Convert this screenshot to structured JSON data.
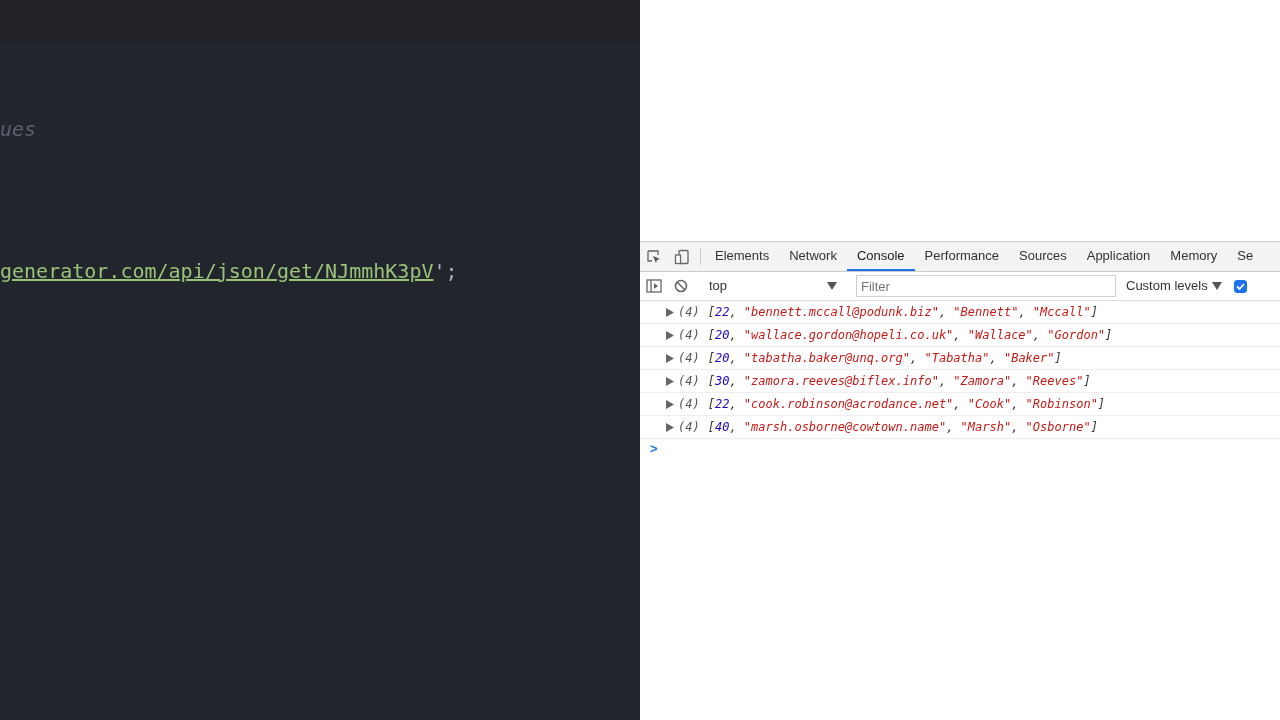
{
  "editor": {
    "comment": "ues",
    "code_line": {
      "url": "generator.com/api/json/get/NJmmhK3pV",
      "rest": "';"
    }
  },
  "devtools": {
    "tabs": [
      {
        "label": "Elements",
        "selected": false
      },
      {
        "label": "Network",
        "selected": false
      },
      {
        "label": "Console",
        "selected": true
      },
      {
        "label": "Performance",
        "selected": false
      },
      {
        "label": "Sources",
        "selected": false
      },
      {
        "label": "Application",
        "selected": false
      },
      {
        "label": "Memory",
        "selected": false
      },
      {
        "label": "Se",
        "selected": false
      }
    ],
    "toolbar": {
      "context": "top",
      "filter": {
        "placeholder": "Filter"
      },
      "levels": "Custom levels",
      "group_checkbox": {
        "checked": true
      }
    },
    "console_rows": [
      {
        "expanded": false,
        "count": "(4)",
        "open": "[",
        "close": "]",
        "items": [
          {
            "kind": "number",
            "text": "22"
          },
          {
            "kind": "string",
            "text": "\"bennett.mccall@podunk.biz\""
          },
          {
            "kind": "string",
            "text": "\"Bennett\""
          },
          {
            "kind": "string",
            "text": "\"Mccall\""
          }
        ]
      },
      {
        "expanded": false,
        "count": "(4)",
        "open": "[",
        "close": "]",
        "items": [
          {
            "kind": "number",
            "text": "20"
          },
          {
            "kind": "string",
            "text": "\"wallace.gordon@hopeli.co.uk\""
          },
          {
            "kind": "string",
            "text": "\"Wallace\""
          },
          {
            "kind": "string",
            "text": "\"Gordon\""
          }
        ]
      },
      {
        "expanded": false,
        "count": "(4)",
        "open": "[",
        "close": "]",
        "items": [
          {
            "kind": "number",
            "text": "20"
          },
          {
            "kind": "string",
            "text": "\"tabatha.baker@unq.org\""
          },
          {
            "kind": "string",
            "text": "\"Tabatha\""
          },
          {
            "kind": "string",
            "text": "\"Baker\""
          }
        ]
      },
      {
        "expanded": false,
        "count": "(4)",
        "open": "[",
        "close": "]",
        "items": [
          {
            "kind": "number",
            "text": "30"
          },
          {
            "kind": "string",
            "text": "\"zamora.reeves@biflex.info\""
          },
          {
            "kind": "string",
            "text": "\"Zamora\""
          },
          {
            "kind": "string",
            "text": "\"Reeves\""
          }
        ]
      },
      {
        "expanded": false,
        "count": "(4)",
        "open": "[",
        "close": "]",
        "items": [
          {
            "kind": "number",
            "text": "22"
          },
          {
            "kind": "string",
            "text": "\"cook.robinson@acrodance.net\""
          },
          {
            "kind": "string",
            "text": "\"Cook\""
          },
          {
            "kind": "string",
            "text": "\"Robinson\""
          }
        ]
      },
      {
        "expanded": false,
        "count": "(4)",
        "open": "[",
        "close": "]",
        "items": [
          {
            "kind": "number",
            "text": "40"
          },
          {
            "kind": "string",
            "text": "\"marsh.osborne@cowtown.name\""
          },
          {
            "kind": "string",
            "text": "\"Marsh\""
          },
          {
            "kind": "string",
            "text": "\"Osborne\""
          }
        ]
      }
    ],
    "separator": ",",
    "prompt": ">"
  }
}
